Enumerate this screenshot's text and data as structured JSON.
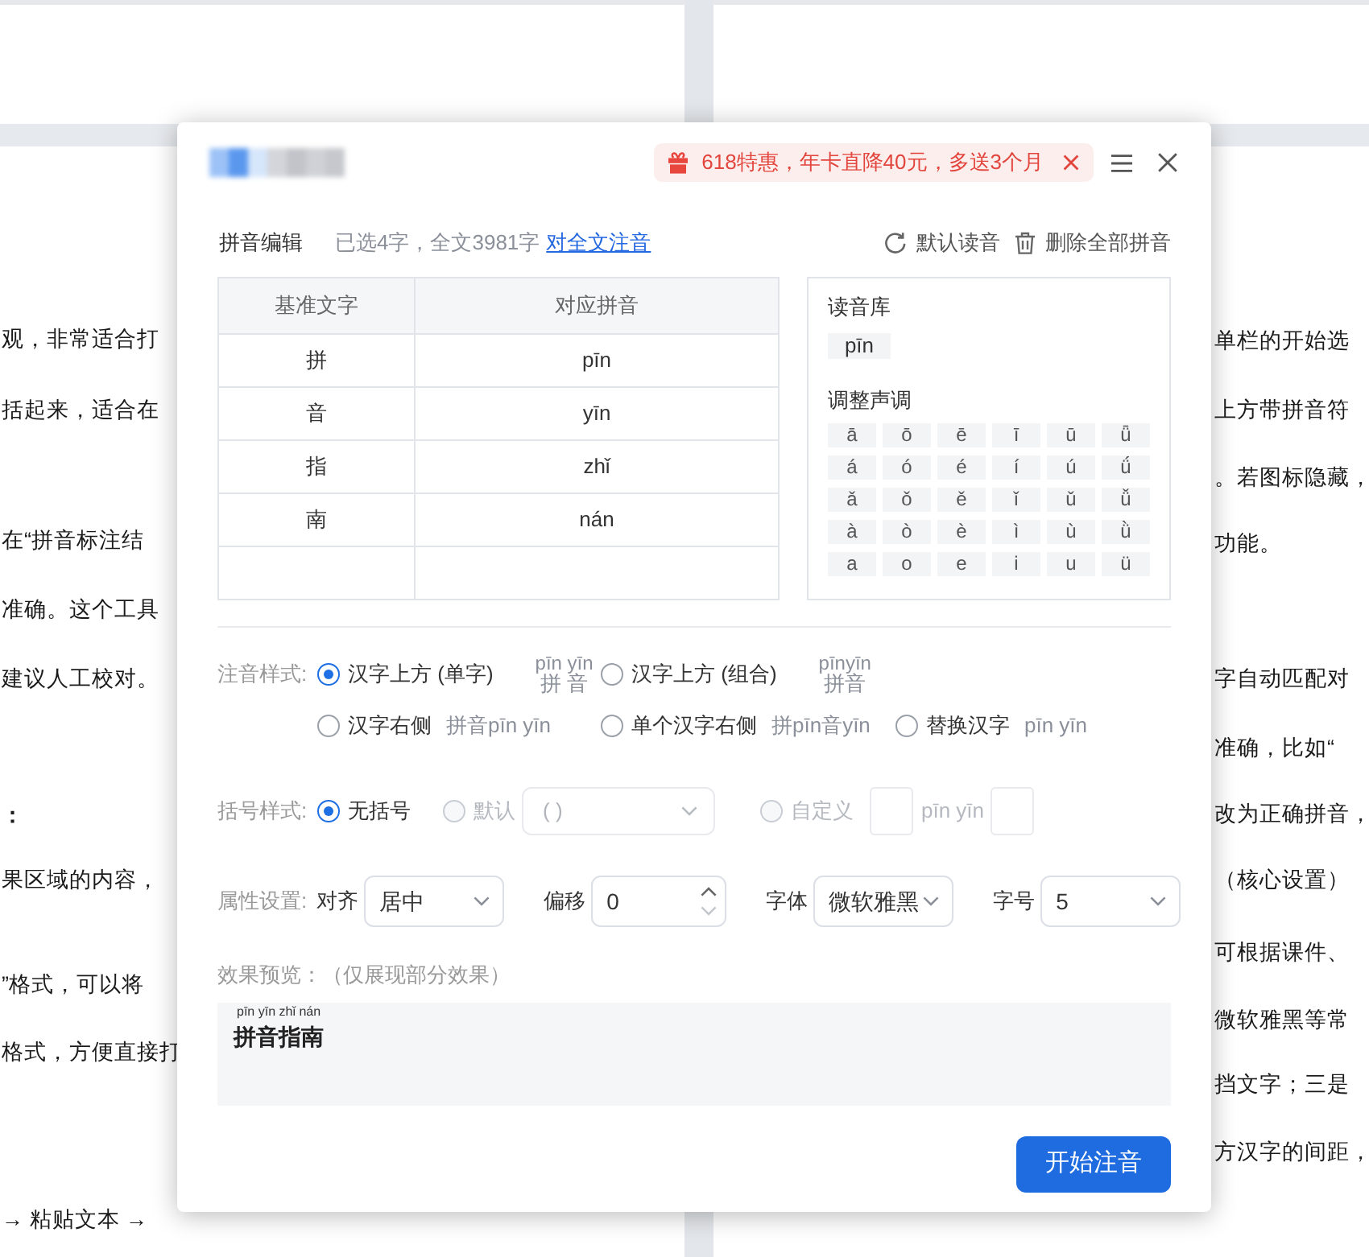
{
  "document": {
    "left_lines": [
      {
        "text": "观，非常适合打",
        "bold": false
      },
      {
        "text": "括起来，适合在",
        "bold": false
      },
      {
        "text": "在“拼音标注结",
        "bold": false
      },
      {
        "text": "准确。这个工具",
        "bold": false
      },
      {
        "text": "建议人工校对。",
        "bold": false
      },
      {
        "text": "：",
        "bold": true
      },
      {
        "text": "果区域的内容，",
        "bold": false
      },
      {
        "text": "”格式，可以将",
        "bold": false
      },
      {
        "text": "格式，方便直接打",
        "bold": false
      },
      {
        "text": "→ 粘贴文本 →",
        "bold": false
      }
    ],
    "right_lines": [
      {
        "text": "单栏的开始选",
        "bold": false
      },
      {
        "text": "上方带拼音符",
        "bold": false
      },
      {
        "text": "。若图标隐藏，",
        "bold": false
      },
      {
        "text": "功能。",
        "bold": false
      },
      {
        "text": "字自动匹配对",
        "bold": false
      },
      {
        "text": "准确，比如“",
        "bold": false
      },
      {
        "text": "改为正确拼音，",
        "bold": false
      },
      {
        "text": "（核心设置）",
        "bold": false
      },
      {
        "text": "可根据课件、",
        "bold": false
      },
      {
        "text": "微软雅黑等常",
        "bold": false
      },
      {
        "text": "挡文字；三是",
        "bold": false
      },
      {
        "text": "方汉字的间距，",
        "bold": false
      }
    ]
  },
  "dialog": {
    "promo": {
      "text": "618特惠，年卡直降40元，多送3个月"
    },
    "editor": {
      "title": "拼音编辑",
      "summary": "已选4字，全文3981字",
      "link": "对全文注音",
      "actions": [
        {
          "kind": "reset",
          "label": "默认读音"
        },
        {
          "kind": "delete",
          "label": "删除全部拼音"
        }
      ]
    },
    "table": {
      "columns": [
        "基准文字",
        "对应拼音"
      ],
      "rows": [
        [
          "拼",
          "pīn"
        ],
        [
          "音",
          "yīn"
        ],
        [
          "指",
          "zhǐ"
        ],
        [
          "南",
          "nán"
        ]
      ]
    },
    "reading_library": {
      "title": "读音库",
      "readings": [
        "pīn"
      ],
      "tone_title": "调整声调",
      "tones": [
        [
          "ā",
          "ō",
          "ē",
          "ī",
          "ū",
          "ǖ"
        ],
        [
          "á",
          "ó",
          "é",
          "í",
          "ú",
          "ǘ"
        ],
        [
          "ǎ",
          "ǒ",
          "ě",
          "ǐ",
          "ǔ",
          "ǚ"
        ],
        [
          "à",
          "ò",
          "è",
          "ì",
          "ù",
          "ǜ"
        ],
        [
          "a",
          "o",
          "e",
          "i",
          "u",
          "ü"
        ]
      ]
    },
    "annotation_style": {
      "label": "注音样式:",
      "rows": [
        [
          {
            "label": "汉字上方 (单字)",
            "selected": true,
            "sample": {
              "kind": "above",
              "pinyin": "pīn yīn",
              "hanzi": "拼 音"
            }
          },
          {
            "label": "汉字上方 (组合)",
            "selected": false,
            "sample": {
              "kind": "above",
              "pinyin": "pīnyīn",
              "hanzi": "拼音"
            }
          }
        ],
        [
          {
            "label": "汉字右侧",
            "selected": false,
            "sample": {
              "kind": "inline",
              "text": "拼音pīn yīn"
            }
          },
          {
            "label": "单个汉字右侧",
            "selected": false,
            "sample": {
              "kind": "inline",
              "text": "拼pīn音yīn"
            }
          },
          {
            "label": "替换汉字",
            "selected": false,
            "sample": {
              "kind": "inline",
              "text": "pīn yīn"
            }
          }
        ]
      ]
    },
    "bracket_style": {
      "label": "括号样式:",
      "options": [
        {
          "kind": "plain",
          "label": "无括号",
          "selected": true,
          "disabled": false
        },
        {
          "kind": "preset",
          "label": "默认",
          "selected": false,
          "disabled": true,
          "value": "( )"
        },
        {
          "kind": "custom",
          "label": "自定义",
          "selected": false,
          "disabled": true,
          "sample": "pīn yīn"
        }
      ]
    },
    "properties": {
      "label": "属性设置:",
      "fields": [
        {
          "kind": "select",
          "label": "对齐",
          "value": "居中"
        },
        {
          "kind": "number",
          "label": "偏移",
          "value": "0"
        },
        {
          "kind": "select",
          "label": "字体",
          "value": "微软雅黑"
        },
        {
          "kind": "select",
          "label": "字号",
          "value": "5"
        }
      ]
    },
    "preview": {
      "label": "效果预览：（仅展现部分效果）",
      "pinyin": "pīn yīn zhǐ nán",
      "text": "拼音指南"
    },
    "start_button": "开始注音"
  }
}
